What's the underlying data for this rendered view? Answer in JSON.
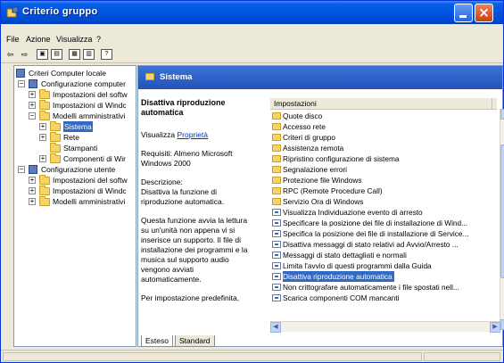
{
  "window": {
    "title": "Criterio gruppo"
  },
  "menu": [
    {
      "label": "File"
    },
    {
      "label": "Azione"
    },
    {
      "label": "Visualizza"
    },
    {
      "label": "?"
    }
  ],
  "tree": {
    "items": [
      {
        "label": "Criteri Computer locale",
        "icon": "policy-icon"
      },
      {
        "label": "Configurazione computer",
        "icon": "computer-config-icon"
      },
      {
        "label": "Impostazioni del softw",
        "icon": "folder-icon"
      },
      {
        "label": "Impostazioni di Windc",
        "icon": "folder-icon"
      },
      {
        "label": "Modelli amministrativi",
        "icon": "folder-icon"
      },
      {
        "label": "Sistema",
        "icon": "folder-icon"
      },
      {
        "label": "Rete",
        "icon": "folder-icon"
      },
      {
        "label": "Stampanti",
        "icon": "folder-icon"
      },
      {
        "label": "Componenti di Wir",
        "icon": "folder-icon"
      },
      {
        "label": "Configurazione utente",
        "icon": "user-config-icon"
      },
      {
        "label": "Impostazioni del softw",
        "icon": "folder-icon"
      },
      {
        "label": "Impostazioni di Windc",
        "icon": "folder-icon"
      },
      {
        "label": "Modelli amministrativi",
        "icon": "folder-icon"
      }
    ]
  },
  "pane": {
    "header": "Sistema",
    "description": {
      "title": "Disattiva riproduzione automatica",
      "show_prefix": "Visualizza",
      "show_link": "Proprietà",
      "requirements": "Requisiti: Almeno Microsoft Windows 2000",
      "description_label": "Descrizione:",
      "description_text": "Disattiva la funzione di riproduzione automatica.",
      "body": "Questa funzione avvia la lettura su un'unità non appena vi si inserisce un supporto. Il file di installazione dei programmi e la musica sul supporto audio vengono avviati automaticamente.",
      "trailing": "Per impostazione predefinita,"
    },
    "list": {
      "header": "Impostazioni",
      "items": [
        {
          "label": "Quote disco",
          "icon": "folder-icon"
        },
        {
          "label": "Accesso rete",
          "icon": "folder-icon"
        },
        {
          "label": "Criteri di gruppo",
          "icon": "folder-icon"
        },
        {
          "label": "Assistenza remota",
          "icon": "folder-icon"
        },
        {
          "label": "Ripristino configurazione di sistema",
          "icon": "folder-icon"
        },
        {
          "label": "Segnalazione errori",
          "icon": "folder-icon"
        },
        {
          "label": "Protezione file Windows",
          "icon": "folder-icon"
        },
        {
          "label": "RPC (Remote Procedure Call)",
          "icon": "folder-icon"
        },
        {
          "label": "Servizio Ora di Windows",
          "icon": "folder-icon"
        },
        {
          "label": "Visualizza Individuazione evento di arresto",
          "icon": "policy-icon",
          "state": "N"
        },
        {
          "label": "Specificare la posizione dei file di installazione di Wind...",
          "icon": "policy-icon",
          "state": "N"
        },
        {
          "label": "Specifica la posizione dei file di installazione di Service...",
          "icon": "policy-icon",
          "state": "N"
        },
        {
          "label": "Disattiva messaggi di stato relativi ad Avvio/Arresto ...",
          "icon": "policy-icon",
          "state": "N"
        },
        {
          "label": "Messaggi di stato dettagliati e normali",
          "icon": "policy-icon",
          "state": "N"
        },
        {
          "label": "Limita l'avvio di questi programmi dalla Guida",
          "icon": "policy-icon",
          "state": "N"
        },
        {
          "label": "Disattiva riproduzione automatica",
          "icon": "policy-icon",
          "state": "N"
        },
        {
          "label": "Non crittografare automaticamente i file spostati nell...",
          "icon": "policy-icon",
          "state": "N"
        },
        {
          "label": "Scarica componenti COM mancanti",
          "icon": "policy-icon",
          "state": "N"
        }
      ]
    },
    "tabs": [
      {
        "label": "Esteso"
      },
      {
        "label": "Standard"
      }
    ]
  },
  "colors": {
    "title_bar": "#0054e3",
    "selection": "#316ac5",
    "pane_header": "#2d61c9"
  }
}
